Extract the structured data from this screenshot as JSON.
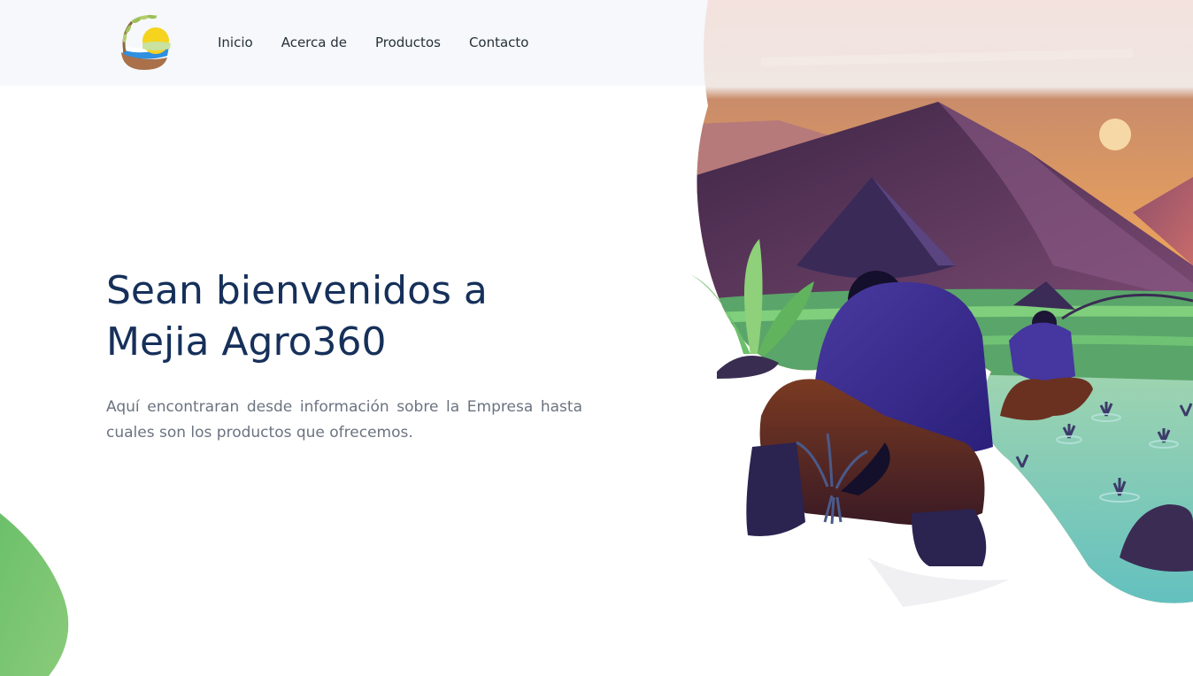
{
  "brand": {
    "logo_icon": "sun-field-tree-logo"
  },
  "nav": {
    "items": [
      {
        "label": "Inicio"
      },
      {
        "label": "Acerca de"
      },
      {
        "label": "Productos"
      },
      {
        "label": "Contacto"
      }
    ]
  },
  "hero": {
    "title_line1": "Sean bienvenidos a",
    "title_line2": "Mejia Agro360",
    "subtitle": "Aquí encontraran desde información sobre la Empresa hasta cuales son los productos que ofrecemos.",
    "illustration_icon": "rice-farmers-illustration"
  },
  "colors": {
    "title": "#16305a",
    "nav_background": "#f6f8fb",
    "accent_green": "#6cc06a"
  }
}
